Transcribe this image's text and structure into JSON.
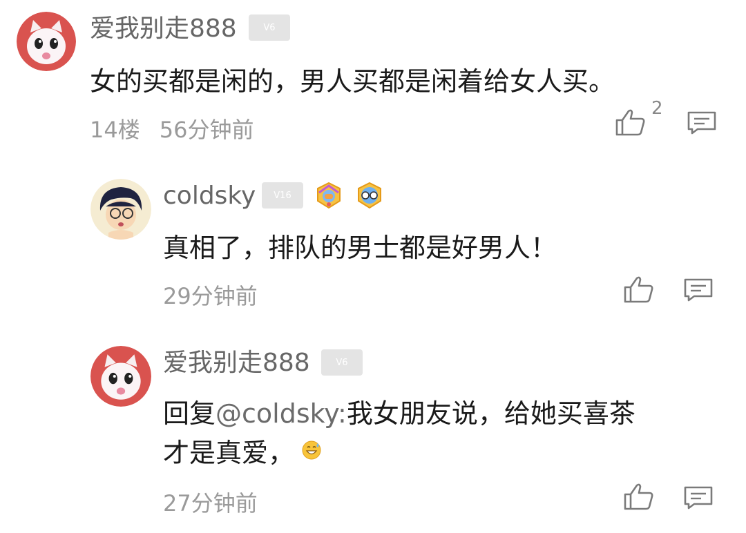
{
  "comments": [
    {
      "username": "爱我别走888",
      "level": "V6",
      "text": "女的买都是闲的，男人买都是闲着给女人买。",
      "floor": "14楼",
      "time": "56分钟前",
      "like_count": "2",
      "avatar": "white-cat-avatar"
    },
    {
      "username": "coldsky",
      "level": "V16",
      "medals": [
        "fist-medal",
        "glasses-medal"
      ],
      "text": "真相了，排队的男士都是好男人！",
      "time": "29分钟前",
      "avatar": "detective-boy-avatar"
    },
    {
      "username": "爱我别走888",
      "level": "V6",
      "reply_prefix": "回复",
      "mention": "@coldsky:",
      "text_line1": "我女朋友说，给她买喜茶",
      "text_line2": "才是真爱，",
      "emoji": "grin-sweat-emoji",
      "time": "27分钟前",
      "avatar": "white-cat-avatar"
    }
  ],
  "icons": {
    "like": "thumbs-up-icon",
    "reply": "comment-icon"
  }
}
